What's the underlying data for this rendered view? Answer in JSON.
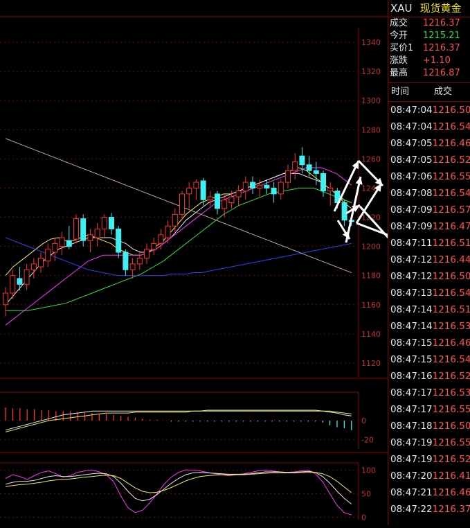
{
  "quote": {
    "symbol": "XAU",
    "name": "现货黄金",
    "fields": [
      {
        "label": "成交",
        "value": "1216.37",
        "color": "red"
      },
      {
        "label": "今开",
        "value": "1215.21",
        "color": "green"
      },
      {
        "label": "买价1",
        "value": "1216.37",
        "color": "red"
      },
      {
        "label": "涨跌",
        "value": "+1.10",
        "color": "red"
      },
      {
        "label": "最高",
        "value": "1216.87",
        "color": "red"
      }
    ],
    "table_header": {
      "time": "时间",
      "price": "成交"
    },
    "ticks": [
      {
        "time": "08:47:04",
        "price": "1216.50"
      },
      {
        "time": "08:47:04",
        "price": "1216.54"
      },
      {
        "time": "08:47:05",
        "price": "1216.46"
      },
      {
        "time": "08:47:05",
        "price": "1216.52"
      },
      {
        "time": "08:47:06",
        "price": "1216.55"
      },
      {
        "time": "08:47:08",
        "price": "1216.54"
      },
      {
        "time": "08:47:09",
        "price": "1216.57"
      },
      {
        "time": "08:47:09",
        "price": "1216.47"
      },
      {
        "time": "08:47:11",
        "price": "1216.51"
      },
      {
        "time": "08:47:12",
        "price": "1216.44"
      },
      {
        "time": "08:47:12",
        "price": "1216.50"
      },
      {
        "time": "08:47:13",
        "price": "1216.54"
      },
      {
        "time": "08:47:14",
        "price": "1216.51"
      },
      {
        "time": "08:47:14",
        "price": "1216.53"
      },
      {
        "time": "08:47:15",
        "price": "1216.46"
      },
      {
        "time": "08:47:15",
        "price": "1216.54"
      },
      {
        "time": "08:47:16",
        "price": "1216.52"
      },
      {
        "time": "08:47:17",
        "price": "1216.53"
      },
      {
        "time": "08:47:17",
        "price": "1216.55"
      },
      {
        "time": "08:47:18",
        "price": "1216.50"
      },
      {
        "time": "08:47:19",
        "price": "1216.55"
      },
      {
        "time": "08:47:19",
        "price": "1216.52"
      },
      {
        "time": "08:47:20",
        "price": "1216.41"
      },
      {
        "time": "08:47:21",
        "price": "1216.46"
      },
      {
        "time": "08:47:22",
        "price": "1216.37"
      }
    ]
  },
  "colors": {
    "up": "#ff3030",
    "down": "#40f0f0",
    "axis": "#c03030",
    "grid": "#8a0000",
    "ma_white": "#e8e8e8",
    "ma_yellow": "#f0f050",
    "ma_magenta": "#ff30ff",
    "ma_green": "#30e030",
    "ma_blue": "#3040ff",
    "ma_gray": "#b0a8a0",
    "arrow": "#ffffff"
  },
  "chart_data": [
    {
      "type": "candlestick",
      "panel": "price",
      "yaxis_ticks": [
        "1340",
        "1320",
        "1300",
        "1280",
        "1260",
        "1240",
        "1220",
        "1200",
        "1180",
        "1160",
        "1140",
        "1120"
      ],
      "ylim": [
        1110,
        1350
      ],
      "grid": true,
      "candles": [
        {
          "o": 1160,
          "h": 1172,
          "l": 1152,
          "c": 1168
        },
        {
          "o": 1168,
          "h": 1184,
          "l": 1164,
          "c": 1180
        },
        {
          "o": 1178,
          "h": 1186,
          "l": 1170,
          "c": 1174
        },
        {
          "o": 1174,
          "h": 1188,
          "l": 1170,
          "c": 1184
        },
        {
          "o": 1184,
          "h": 1192,
          "l": 1178,
          "c": 1188
        },
        {
          "o": 1186,
          "h": 1196,
          "l": 1182,
          "c": 1192
        },
        {
          "o": 1190,
          "h": 1202,
          "l": 1186,
          "c": 1198
        },
        {
          "o": 1196,
          "h": 1206,
          "l": 1190,
          "c": 1202
        },
        {
          "o": 1200,
          "h": 1210,
          "l": 1194,
          "c": 1206
        },
        {
          "o": 1204,
          "h": 1214,
          "l": 1198,
          "c": 1200
        },
        {
          "o": 1205,
          "h": 1222,
          "l": 1202,
          "c": 1219
        },
        {
          "o": 1219,
          "h": 1222,
          "l": 1200,
          "c": 1204
        },
        {
          "o": 1204,
          "h": 1212,
          "l": 1196,
          "c": 1208
        },
        {
          "o": 1206,
          "h": 1216,
          "l": 1200,
          "c": 1212
        },
        {
          "o": 1212,
          "h": 1222,
          "l": 1206,
          "c": 1220
        },
        {
          "o": 1220,
          "h": 1223,
          "l": 1208,
          "c": 1212
        },
        {
          "o": 1212,
          "h": 1214,
          "l": 1192,
          "c": 1196
        },
        {
          "o": 1196,
          "h": 1198,
          "l": 1180,
          "c": 1184
        },
        {
          "o": 1184,
          "h": 1192,
          "l": 1178,
          "c": 1188
        },
        {
          "o": 1188,
          "h": 1196,
          "l": 1184,
          "c": 1192
        },
        {
          "o": 1192,
          "h": 1202,
          "l": 1188,
          "c": 1198
        },
        {
          "o": 1198,
          "h": 1206,
          "l": 1194,
          "c": 1202
        },
        {
          "o": 1202,
          "h": 1212,
          "l": 1198,
          "c": 1208
        },
        {
          "o": 1206,
          "h": 1218,
          "l": 1202,
          "c": 1214
        },
        {
          "o": 1214,
          "h": 1226,
          "l": 1210,
          "c": 1222
        },
        {
          "o": 1222,
          "h": 1238,
          "l": 1218,
          "c": 1236
        },
        {
          "o": 1236,
          "h": 1244,
          "l": 1226,
          "c": 1240
        },
        {
          "o": 1240,
          "h": 1246,
          "l": 1232,
          "c": 1244
        },
        {
          "o": 1245,
          "h": 1247,
          "l": 1228,
          "c": 1232
        },
        {
          "o": 1232,
          "h": 1238,
          "l": 1228,
          "c": 1234
        },
        {
          "o": 1236,
          "h": 1238,
          "l": 1222,
          "c": 1226
        },
        {
          "o": 1226,
          "h": 1236,
          "l": 1220,
          "c": 1232
        },
        {
          "o": 1230,
          "h": 1238,
          "l": 1226,
          "c": 1234
        },
        {
          "o": 1234,
          "h": 1242,
          "l": 1228,
          "c": 1238
        },
        {
          "o": 1238,
          "h": 1248,
          "l": 1232,
          "c": 1244
        },
        {
          "o": 1244,
          "h": 1248,
          "l": 1236,
          "c": 1240
        },
        {
          "o": 1240,
          "h": 1246,
          "l": 1234,
          "c": 1242
        },
        {
          "o": 1242,
          "h": 1246,
          "l": 1236,
          "c": 1240
        },
        {
          "o": 1240,
          "h": 1244,
          "l": 1230,
          "c": 1236
        },
        {
          "o": 1236,
          "h": 1246,
          "l": 1232,
          "c": 1244
        },
        {
          "o": 1244,
          "h": 1256,
          "l": 1240,
          "c": 1252
        },
        {
          "o": 1252,
          "h": 1264,
          "l": 1246,
          "c": 1258
        },
        {
          "o": 1262,
          "h": 1268,
          "l": 1250,
          "c": 1256
        },
        {
          "o": 1256,
          "h": 1262,
          "l": 1248,
          "c": 1252
        },
        {
          "o": 1252,
          "h": 1258,
          "l": 1242,
          "c": 1250
        },
        {
          "o": 1250,
          "h": 1252,
          "l": 1234,
          "c": 1238
        },
        {
          "o": 1238,
          "h": 1244,
          "l": 1228,
          "c": 1240
        },
        {
          "o": 1238,
          "h": 1240,
          "l": 1226,
          "c": 1230
        },
        {
          "o": 1230,
          "h": 1232,
          "l": 1214,
          "c": 1218
        },
        {
          "o": 1218,
          "h": 1222,
          "l": 1214,
          "c": 1217
        }
      ],
      "series": [
        {
          "color_key": "ma_yellow",
          "values": [
            1180,
            1186,
            1190,
            1194,
            1198,
            1202,
            1205,
            1206,
            1204,
            1204,
            1206,
            1208,
            1206,
            1204,
            1202,
            1198,
            1196,
            1194,
            1194,
            1196,
            1200,
            1204,
            1210,
            1216,
            1222,
            1226,
            1230,
            1232,
            1234,
            1236,
            1236,
            1238,
            1240,
            1242,
            1244,
            1246,
            1248,
            1250,
            1252,
            1254,
            1252,
            1248,
            1244,
            1240,
            1236,
            1230,
            1226
          ]
        },
        {
          "color_key": "ma_white",
          "values": [
            1160,
            1166,
            1172,
            1178,
            1184,
            1190,
            1194,
            1198,
            1200,
            1202,
            1204,
            1206,
            1206,
            1206,
            1206,
            1204,
            1202,
            1198,
            1196,
            1196,
            1198,
            1202,
            1206,
            1212,
            1218,
            1222,
            1226,
            1230,
            1232,
            1234,
            1236,
            1238,
            1240,
            1242,
            1244,
            1246,
            1248,
            1250,
            1250,
            1250,
            1248,
            1246,
            1244,
            1240,
            1236,
            1232,
            1230
          ]
        },
        {
          "color_key": "ma_magenta",
          "values": [
            1146,
            1150,
            1154,
            1158,
            1162,
            1166,
            1170,
            1174,
            1178,
            1182,
            1186,
            1190,
            1192,
            1194,
            1194,
            1194,
            1194,
            1194,
            1194,
            1196,
            1198,
            1202,
            1206,
            1210,
            1214,
            1218,
            1222,
            1226,
            1230,
            1232,
            1234,
            1236,
            1238,
            1240,
            1242,
            1244,
            1246,
            1248,
            1250,
            1252,
            1254,
            1254,
            1254,
            1252,
            1250,
            1246,
            1242
          ]
        },
        {
          "color_key": "ma_green",
          "values": [
            1156,
            1156,
            1156,
            1156,
            1157,
            1158,
            1159,
            1160,
            1161,
            1163,
            1165,
            1167,
            1169,
            1171,
            1173,
            1175,
            1177,
            1179,
            1181,
            1184,
            1187,
            1190,
            1194,
            1198,
            1202,
            1206,
            1210,
            1214,
            1218,
            1222,
            1225,
            1228,
            1230,
            1232,
            1234,
            1236,
            1237,
            1238,
            1239,
            1240,
            1240,
            1240,
            1238,
            1236,
            1234,
            1232,
            1230
          ]
        },
        {
          "color_key": "ma_blue",
          "values": [
            1206,
            1204,
            1202,
            1200,
            1198,
            1196,
            1194,
            1192,
            1190,
            1188,
            1186,
            1184,
            1183,
            1182,
            1181,
            1180,
            1180,
            1180,
            1180,
            1180,
            1180,
            1180,
            1181,
            1181,
            1181,
            1182,
            1182,
            1183,
            1184,
            1185,
            1186,
            1187,
            1188,
            1189,
            1190,
            1191,
            1192,
            1193,
            1194,
            1195,
            1196,
            1197,
            1198,
            1199,
            1200,
            1201,
            1202
          ]
        },
        {
          "color_key": "ma_gray",
          "values": [
            1274,
            1272,
            1270,
            1268,
            1266,
            1264,
            1262,
            1260,
            1258,
            1256,
            1254,
            1252,
            1250,
            1248,
            1246,
            1244,
            1242,
            1240,
            1238,
            1236,
            1234,
            1232,
            1230,
            1228,
            1226,
            1224,
            1222,
            1220,
            1218,
            1216,
            1214,
            1212,
            1210,
            1208,
            1206,
            1204,
            1202,
            1200,
            1198,
            1196,
            1194,
            1192,
            1190,
            1188,
            1186,
            1184,
            1182
          ]
        }
      ]
    },
    {
      "type": "bar",
      "panel": "macd",
      "yaxis_ticks": [
        "0",
        "-20"
      ],
      "ylim": [
        -30,
        30
      ],
      "histogram": [
        14,
        13,
        13,
        12,
        12,
        11,
        11,
        10,
        10,
        10,
        9,
        9,
        8,
        7,
        7,
        6,
        5,
        4,
        3,
        2,
        1,
        1,
        0,
        -1,
        -1,
        -1,
        -1,
        -1,
        -1,
        -1,
        -1,
        -1,
        -1,
        -1,
        -1,
        -1,
        -1,
        -1,
        -1,
        -1,
        -1,
        -1,
        -1,
        -1,
        -2,
        -5,
        -7,
        -8,
        -10
      ],
      "series": [
        {
          "color_key": "ma_white",
          "values": [
            -10,
            -8,
            -6,
            -4,
            -2,
            0,
            2,
            4,
            6,
            7,
            8,
            9,
            10,
            10,
            10,
            10,
            10,
            10,
            10,
            10,
            10,
            10,
            10,
            10,
            10,
            10,
            10,
            10,
            11,
            11,
            11,
            11,
            11,
            11,
            11,
            11,
            11,
            11,
            11,
            11,
            11,
            11,
            11,
            11,
            10,
            9,
            8,
            6,
            5
          ]
        },
        {
          "color_key": "ma_yellow",
          "values": [
            -12,
            -10,
            -8,
            -6,
            -4,
            -2,
            0,
            1,
            2,
            3,
            4,
            5,
            6,
            7,
            8,
            8,
            8,
            8,
            9,
            9,
            9,
            9,
            9,
            9,
            9,
            9,
            10,
            10,
            10,
            10,
            10,
            10,
            10,
            10,
            10,
            10,
            10,
            10,
            10,
            10,
            10,
            10,
            10,
            10,
            10,
            10,
            9,
            8,
            7
          ]
        }
      ]
    },
    {
      "type": "line",
      "panel": "kdj",
      "yaxis_ticks": [
        "100",
        "50",
        "0"
      ],
      "ylim": [
        -5,
        115
      ],
      "series": [
        {
          "color_key": "ma_magenta",
          "values": [
            82,
            90,
            86,
            80,
            88,
            95,
            98,
            92,
            85,
            88,
            95,
            98,
            100,
            96,
            90,
            75,
            45,
            20,
            10,
            15,
            30,
            50,
            70,
            85,
            95,
            100,
            100,
            98,
            95,
            92,
            90,
            88,
            90,
            92,
            95,
            98,
            100,
            98,
            96,
            95,
            96,
            98,
            100,
            92,
            75,
            50,
            25,
            10,
            5
          ]
        },
        {
          "color_key": "ma_white",
          "values": [
            70,
            74,
            76,
            76,
            78,
            82,
            86,
            88,
            86,
            86,
            88,
            90,
            92,
            93,
            92,
            86,
            72,
            55,
            40,
            35,
            38,
            48,
            60,
            72,
            82,
            90,
            94,
            95,
            94,
            93,
            92,
            91,
            91,
            91,
            92,
            94,
            96,
            96,
            96,
            95,
            95,
            96,
            97,
            95,
            86,
            72,
            55,
            40,
            28
          ]
        },
        {
          "color_key": "ma_yellow",
          "values": [
            65,
            67,
            69,
            70,
            72,
            74,
            77,
            79,
            80,
            81,
            83,
            85,
            86,
            88,
            89,
            88,
            82,
            72,
            62,
            55,
            52,
            53,
            57,
            63,
            70,
            77,
            82,
            86,
            88,
            89,
            90,
            90,
            90,
            90,
            91,
            92,
            93,
            94,
            94,
            94,
            94,
            95,
            95,
            95,
            92,
            86,
            76,
            64,
            52
          ]
        }
      ]
    }
  ]
}
